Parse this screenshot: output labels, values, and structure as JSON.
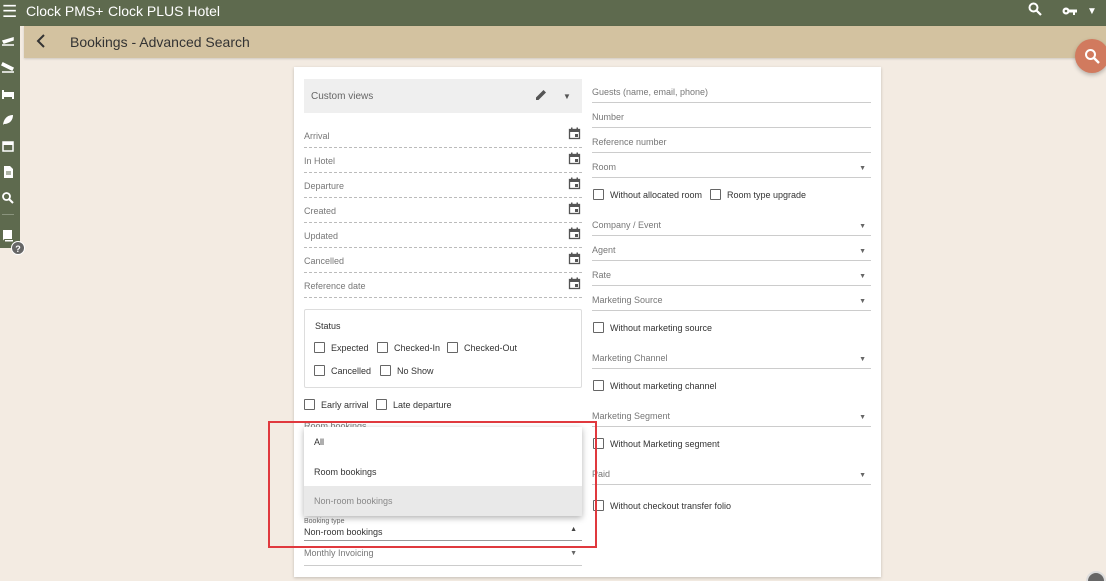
{
  "app": {
    "menu_icon": "menu-icon",
    "brand": "Clock PMS+",
    "hotel": "Clock PLUS Hotel"
  },
  "header": {
    "title": "Bookings - Advanced Search"
  },
  "sidebar": {
    "icons": [
      "departures-icon",
      "arrivals-icon",
      "bed-icon",
      "leaf-icon",
      "calendar-icon",
      "document-icon",
      "search-icon",
      "book-icon"
    ]
  },
  "custom_views": {
    "label": "Custom views"
  },
  "date_fields": [
    "Arrival",
    "In Hotel",
    "Departure",
    "Created",
    "Updated",
    "Cancelled",
    "Reference date"
  ],
  "status": {
    "title": "Status",
    "options": [
      "Expected",
      "Checked-In",
      "Checked-Out",
      "Cancelled",
      "No Show"
    ]
  },
  "extras": {
    "early_arrival": "Early arrival",
    "late_departure": "Late departure"
  },
  "behind_label": "Room bookings",
  "booking_type_menu": {
    "options": [
      "All",
      "Room bookings",
      "Non-room bookings"
    ],
    "selected": "Non-room bookings"
  },
  "booking_type": {
    "label": "Booking type",
    "value": "Non-room bookings"
  },
  "monthly_invoicing": {
    "label": "Monthly Invoicing"
  },
  "right": {
    "guests": "Guests (name, email, phone)",
    "number": "Number",
    "reference_number": "Reference number",
    "room": "Room",
    "without_allocated_room": "Without allocated room",
    "room_type_upgrade": "Room type upgrade",
    "company_event": "Company / Event",
    "agent": "Agent",
    "rate": "Rate",
    "marketing_source": "Marketing Source",
    "without_marketing_source": "Without marketing source",
    "marketing_channel": "Marketing Channel",
    "without_marketing_channel": "Without marketing channel",
    "marketing_segment": "Marketing Segment",
    "without_marketing_segment": "Without Marketing segment",
    "paid": "Paid",
    "without_checkout_transfer_folio": "Without checkout transfer folio"
  },
  "colors": {
    "topbar": "#5e6a4e",
    "headbar": "#d3c2a0",
    "background": "#f3ebe2",
    "fab": "#d17a5e",
    "highlight": "#e0393e"
  }
}
